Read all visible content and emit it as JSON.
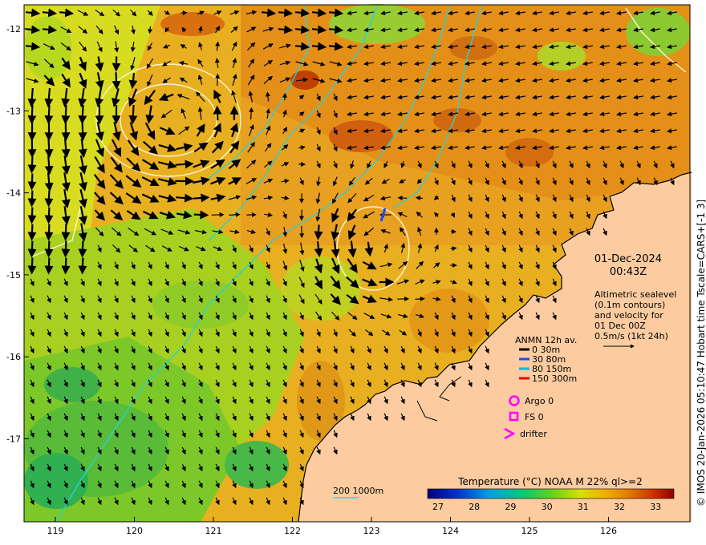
{
  "map": {
    "x_axis": {
      "ticks": [
        "119",
        "120",
        "121",
        "122",
        "123",
        "124",
        "125",
        "126"
      ]
    },
    "y_axis": {
      "ticks": [
        "-12",
        "-13",
        "-14",
        "-15",
        "-16",
        "-17"
      ]
    },
    "datetime": {
      "date": "01-Dec-2024",
      "time": "00:43Z"
    },
    "altimetry_note": [
      "Altimetric sealevel",
      "(0.1m contours)",
      "and velocity for",
      "01 Dec 00Z",
      "0.5m/s (1kt 24h)"
    ],
    "anmn": {
      "title": "ANMN 12h av.",
      "items": [
        {
          "label": "0 30m",
          "color": "#000000"
        },
        {
          "label": "30 80m",
          "color": "#1a4dff"
        },
        {
          "label": "80 150m",
          "color": "#00b8e6"
        },
        {
          "label": "150 300m",
          "color": "#ee0000"
        }
      ]
    },
    "markers": [
      {
        "label": "Argo 0",
        "color": "#ff00ff",
        "symbol": "circle"
      },
      {
        "label": "FS 0",
        "color": "#ff00ff",
        "symbol": "square"
      },
      {
        "label": "drifter",
        "color": "#ff00ff",
        "symbol": "chevron"
      }
    ],
    "depth_legend": "200  1000m",
    "colorbar": {
      "title": "Temperature (°C) NOAA  M 22% ql>=2",
      "ticks": [
        "27",
        "28",
        "29",
        "30",
        "31",
        "32",
        "33"
      ]
    },
    "side_text": "© IMOS 20-Jan-2026 05:10:47 Hobart time Tscale=CARS+[-1 3]",
    "colors": {
      "land": "#fccca0",
      "coast": "#000000",
      "contour": "#fff5d0",
      "isobath": "#22d3e0"
    }
  }
}
